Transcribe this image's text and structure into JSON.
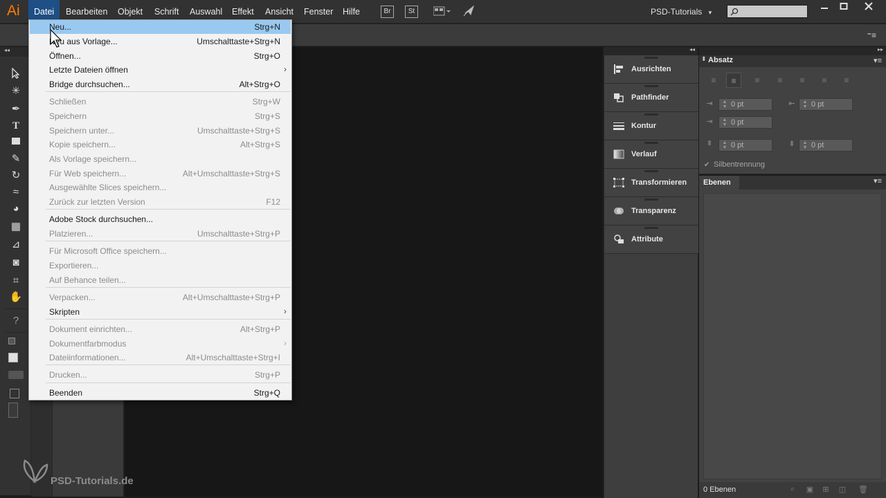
{
  "app": {
    "logo": "Ai",
    "workspace": "PSD-Tutorials"
  },
  "menubar": [
    {
      "label": "Datei"
    },
    {
      "label": "Bearbeiten"
    },
    {
      "label": "Objekt"
    },
    {
      "label": "Schrift"
    },
    {
      "label": "Auswahl"
    },
    {
      "label": "Effekt"
    },
    {
      "label": "Ansicht"
    },
    {
      "label": "Fenster"
    },
    {
      "label": "Hilfe"
    }
  ],
  "bridge_buttons": {
    "br": "Br",
    "st": "St"
  },
  "datei_menu": {
    "items": [
      {
        "label": "Neu...",
        "shortcut": "Strg+N",
        "disabled": false,
        "highlighted": true
      },
      {
        "label": "Neu aus Vorlage...",
        "shortcut": "Umschalttaste+Strg+N",
        "disabled": false
      },
      {
        "label": "Öffnen...",
        "shortcut": "Strg+O",
        "disabled": false
      },
      {
        "label": "Letzte Dateien öffnen",
        "shortcut": "",
        "disabled": false,
        "submenu": true
      },
      {
        "label": "Bridge durchsuchen...",
        "shortcut": "Alt+Strg+O",
        "disabled": false
      },
      {
        "label": "Schließen",
        "shortcut": "Strg+W",
        "disabled": true
      },
      {
        "label": "Speichern",
        "shortcut": "Strg+S",
        "disabled": true
      },
      {
        "label": "Speichern unter...",
        "shortcut": "Umschalttaste+Strg+S",
        "disabled": true
      },
      {
        "label": "Kopie speichern...",
        "shortcut": "Alt+Strg+S",
        "disabled": true
      },
      {
        "label": "Als Vorlage speichern...",
        "shortcut": "",
        "disabled": true
      },
      {
        "label": "Für Web speichern...",
        "shortcut": "Alt+Umschalttaste+Strg+S",
        "disabled": true
      },
      {
        "label": "Ausgewählte Slices speichern...",
        "shortcut": "",
        "disabled": true
      },
      {
        "label": "Zurück zur letzten Version",
        "shortcut": "F12",
        "disabled": true
      },
      {
        "label": "Adobe Stock durchsuchen...",
        "shortcut": "",
        "disabled": false
      },
      {
        "label": "Platzieren...",
        "shortcut": "Umschalttaste+Strg+P",
        "disabled": true
      },
      {
        "label": "Für Microsoft Office speichern...",
        "shortcut": "",
        "disabled": true
      },
      {
        "label": "Exportieren...",
        "shortcut": "",
        "disabled": true
      },
      {
        "label": "Auf Behance teilen...",
        "shortcut": "",
        "disabled": true
      },
      {
        "label": "Verpacken...",
        "shortcut": "Alt+Umschalttaste+Strg+P",
        "disabled": true
      },
      {
        "label": "Skripten",
        "shortcut": "",
        "disabled": false,
        "submenu": true
      },
      {
        "label": "Dokument einrichten...",
        "shortcut": "Alt+Strg+P",
        "disabled": true
      },
      {
        "label": "Dokumentfarbmodus",
        "shortcut": "",
        "disabled": true,
        "submenu": true
      },
      {
        "label": "Dateiinformationen...",
        "shortcut": "Alt+Umschalttaste+Strg+I",
        "disabled": true
      },
      {
        "label": "Drucken...",
        "shortcut": "Strg+P",
        "disabled": true
      },
      {
        "label": "Beenden",
        "shortcut": "Strg+Q",
        "disabled": false
      }
    ]
  },
  "dock_panels": [
    {
      "label": "Ausrichten",
      "icon": "align-icon"
    },
    {
      "label": "Pathfinder",
      "icon": "pathfinder-icon"
    },
    {
      "label": "Kontur",
      "icon": "stroke-icon"
    },
    {
      "label": "Verlauf",
      "icon": "gradient-icon"
    },
    {
      "label": "Transformieren",
      "icon": "transform-icon"
    },
    {
      "label": "Transparenz",
      "icon": "transparency-icon"
    },
    {
      "label": "Attribute",
      "icon": "attributes-icon"
    }
  ],
  "absatz_panel": {
    "title": "Absatz",
    "fields": {
      "indent_left": "0 pt",
      "indent_right": "0 pt",
      "first_line": "0 pt",
      "space_before": "0 pt",
      "space_after": "0 pt"
    },
    "hyphenation_label": "Silbentrennung"
  },
  "ebenen_panel": {
    "title": "Ebenen",
    "count": "0 Ebenen"
  },
  "watermark": {
    "text": "PSD-Tutorials.de"
  },
  "colors": {
    "accent": "#ff7c00",
    "menu_highlight": "#99c9f0",
    "menubar_active": "#1e4f86"
  }
}
